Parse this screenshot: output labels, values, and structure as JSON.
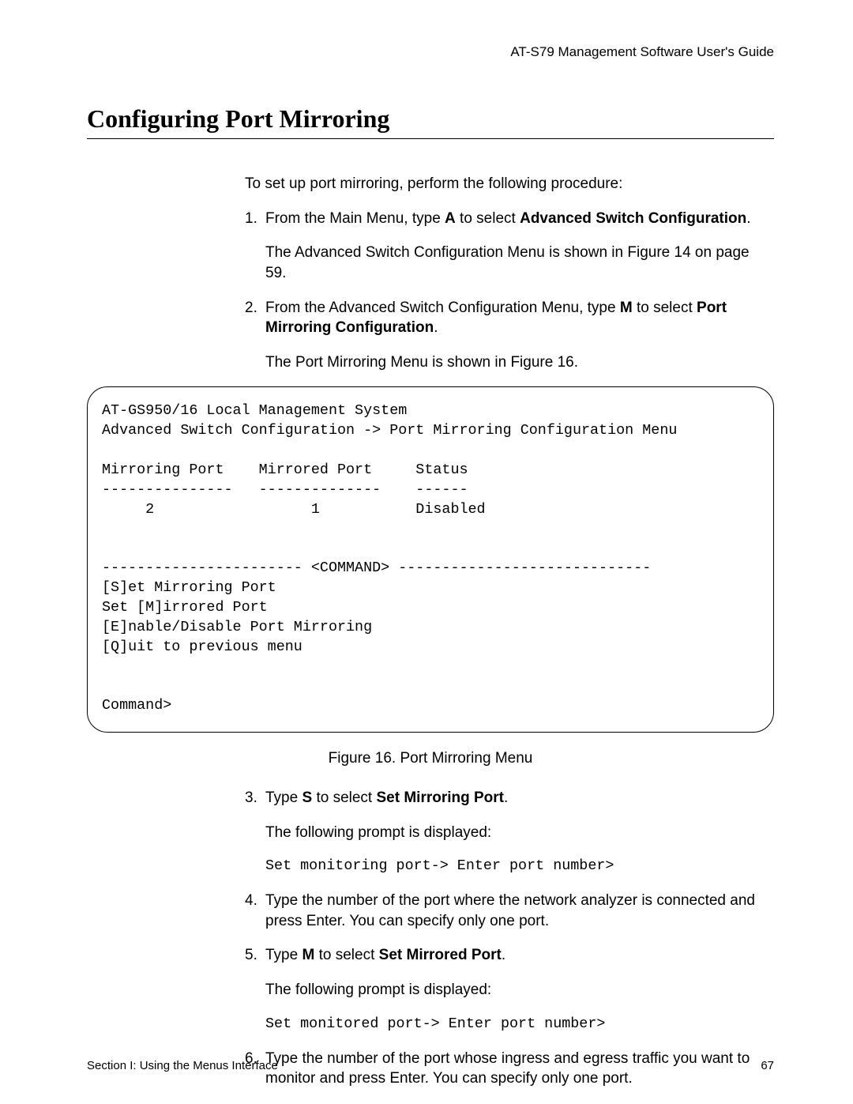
{
  "header": {
    "doc_title": "AT-S79 Management Software User's Guide"
  },
  "section": {
    "title": "Configuring Port Mirroring"
  },
  "intro": "To set up port mirroring, perform the following procedure:",
  "steps": {
    "s1": {
      "num": "1.",
      "pre": "From the Main Menu, type ",
      "key": "A",
      "mid": " to select ",
      "bold": "Advanced Switch Configuration",
      "post": ".",
      "follow": "The Advanced Switch Configuration Menu is shown in Figure 14 on page 59."
    },
    "s2": {
      "num": "2.",
      "pre": "From the Advanced Switch Configuration Menu, type ",
      "key": "M",
      "mid": " to select ",
      "bold": "Port Mirroring Configuration",
      "post": ".",
      "follow": "The Port Mirroring Menu is shown in Figure 16."
    },
    "s3": {
      "num": "3.",
      "pre": "Type ",
      "key": "S",
      "mid": " to select ",
      "bold": "Set Mirroring Port",
      "post": ".",
      "follow": "The following prompt is displayed:",
      "code": "Set monitoring port-> Enter port number>"
    },
    "s4": {
      "num": "4.",
      "text": "Type the number of the port where the network analyzer is connected and press Enter. You can specify only one port."
    },
    "s5": {
      "num": "5.",
      "pre": "Type ",
      "key": "M",
      "mid": " to select ",
      "bold": "Set Mirrored Port",
      "post": ".",
      "follow": "The following prompt is displayed:",
      "code": "Set monitored port-> Enter port number>"
    },
    "s6": {
      "num": "6.",
      "text": "Type the number of the port whose ingress and egress traffic you want to monitor and press Enter. You can specify only one port."
    }
  },
  "terminal": {
    "l1": "AT-GS950/16 Local Management System",
    "l2": "Advanced Switch Configuration -> Port Mirroring Configuration Menu",
    "l3": "",
    "l4": "Mirroring Port    Mirrored Port     Status",
    "l5": "---------------   --------------    ------",
    "l6": "     2                  1           Disabled",
    "l7": "",
    "l8": "",
    "l9": "----------------------- <COMMAND> -----------------------------",
    "l10": "[S]et Mirroring Port",
    "l11": "Set [M]irrored Port",
    "l12": "[E]nable/Disable Port Mirroring",
    "l13": "[Q]uit to previous menu",
    "l14": "",
    "l15": "",
    "l16": "Command>"
  },
  "figure": {
    "caption": "Figure 16. Port Mirroring Menu"
  },
  "footer": {
    "left": "Section I: Using the Menus Interface",
    "right": "67"
  }
}
